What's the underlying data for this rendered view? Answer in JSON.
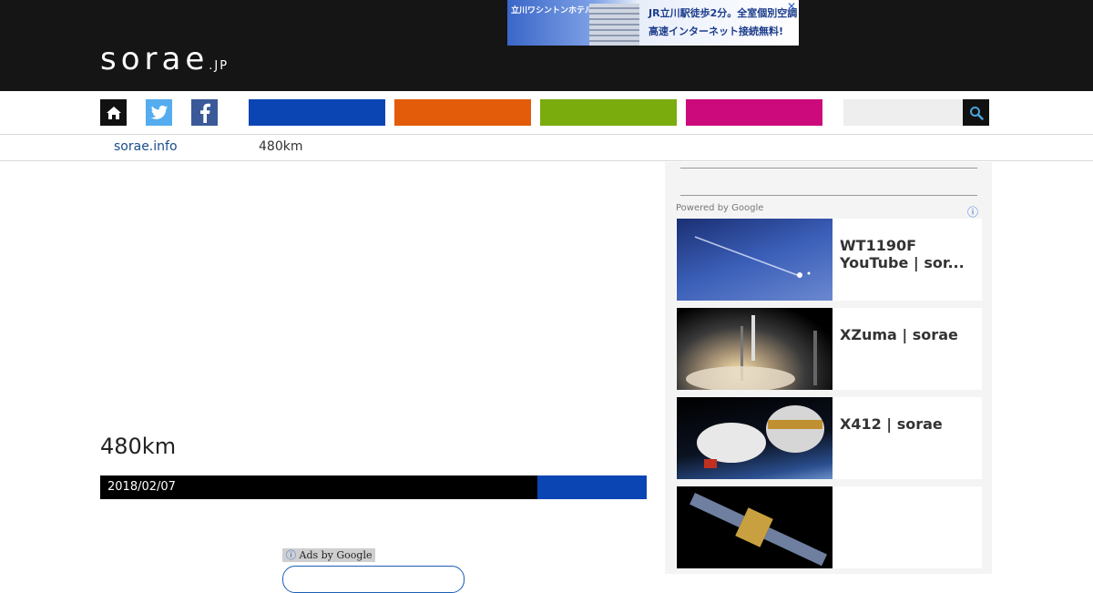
{
  "header": {
    "logo_main": "sorae",
    "logo_tld": ".JP",
    "ad": {
      "left_text": "立川ワシントンホテル",
      "line1": "JR立川駅徒歩2分。全室個別空調",
      "line2": "高速インターネット接続無料!",
      "close": "✕"
    }
  },
  "nav": {
    "search": {
      "placeholder": ""
    },
    "colors": {
      "news": "#0a45b3",
      "rocket": "#e25c0a",
      "planet": "#7aac0e",
      "astro": "#cc0a7c"
    }
  },
  "breadcrumb": {
    "home": "sorae.info",
    "current": "480km"
  },
  "article": {
    "title": "480km",
    "date": "2018/02/07",
    "ads_by": "Ads by Google",
    "ads_icon": "ⓘ"
  },
  "sidebar": {
    "powered_by": "Powered by Google",
    "info_icon": "ⓘ",
    "related": [
      {
        "title": "WT1190F YouTube | sor..."
      },
      {
        "title": "XZuma | sorae"
      },
      {
        "title": "X412 | sorae"
      },
      {
        "title": ""
      }
    ]
  }
}
